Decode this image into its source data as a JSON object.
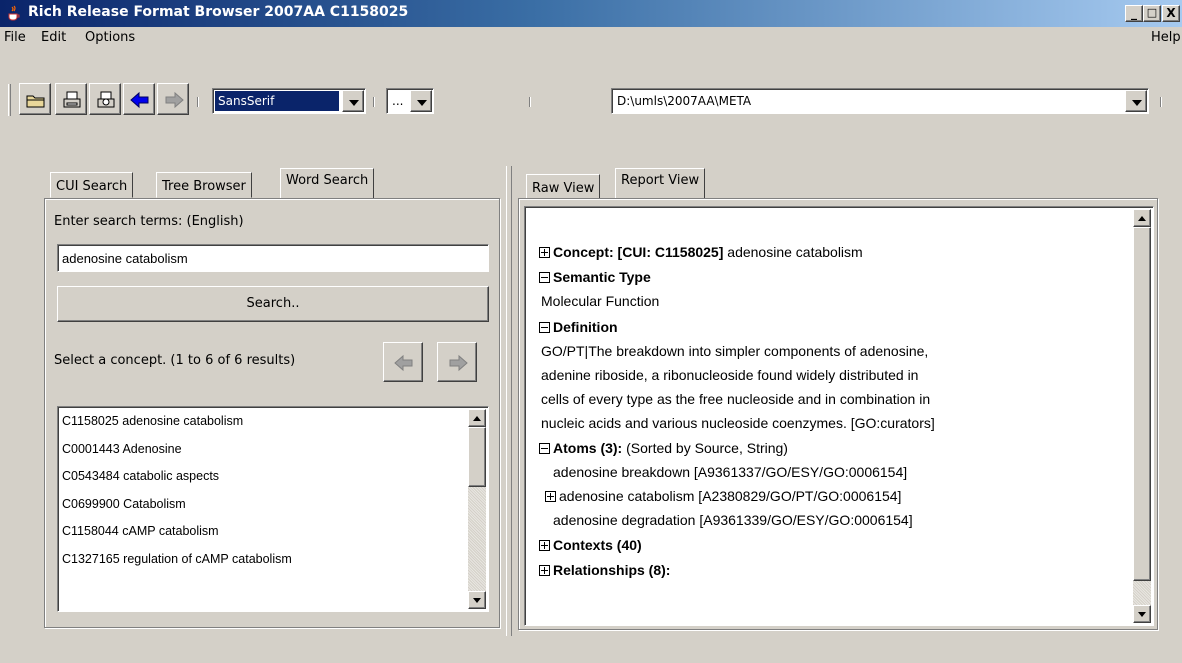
{
  "window": {
    "title": "Rich Release Format Browser 2007AA C1158025",
    "buttons": {
      "minimize": "_",
      "maximize": "□",
      "close": "X"
    }
  },
  "menu": {
    "file": "File",
    "edit": "Edit",
    "options": "Options",
    "help": "Help"
  },
  "toolbar": {
    "font_value": "SansSerif",
    "size_value": "...",
    "path_value": "D:\\umls\\2007AA\\META"
  },
  "left_panel": {
    "tabs": [
      "CUI Search",
      "Tree Browser",
      "Word Search"
    ],
    "active_tab": "Word Search",
    "search_label": "Enter search terms: (English)",
    "search_value": "adenosine catabolism",
    "search_button": "Search..",
    "results_label": "Select a concept. (1 to 6 of 6 results)",
    "results": [
      "C1158025 adenosine catabolism",
      "C0001443 Adenosine",
      "C0543484 catabolic aspects",
      "C0699900 Catabolism",
      "C1158044 cAMP catabolism",
      "C1327165 regulation of cAMP catabolism"
    ]
  },
  "right_panel": {
    "tabs": [
      "Raw View",
      "Report View"
    ],
    "active_tab": "Report View",
    "report": {
      "concept_label": "Concept: [CUI: C1158025]",
      "concept_name": "adenosine catabolism",
      "semantic_type_label": "Semantic Type",
      "semantic_type": "Molecular Function",
      "definition_label": "Definition",
      "definition_lines": [
        "GO/PT|The breakdown into simpler components of adenosine,",
        "adenine riboside, a ribonucleoside found widely distributed in",
        "cells of every type as the free nucleoside and in combination in",
        "nucleic acids and various nucleoside coenzymes. [GO:curators]"
      ],
      "atoms_label": "Atoms (3):",
      "atoms_note": "(Sorted by Source, String)",
      "atoms": [
        "adenosine breakdown [A9361337/GO/ESY/GO:0006154]",
        "adenosine catabolism [A2380829/GO/PT/GO:0006154]",
        "adenosine degradation [A9361339/GO/ESY/GO:0006154]"
      ],
      "contexts_label": "Contexts (40)",
      "relationships_label": "Relationships (8):"
    }
  }
}
